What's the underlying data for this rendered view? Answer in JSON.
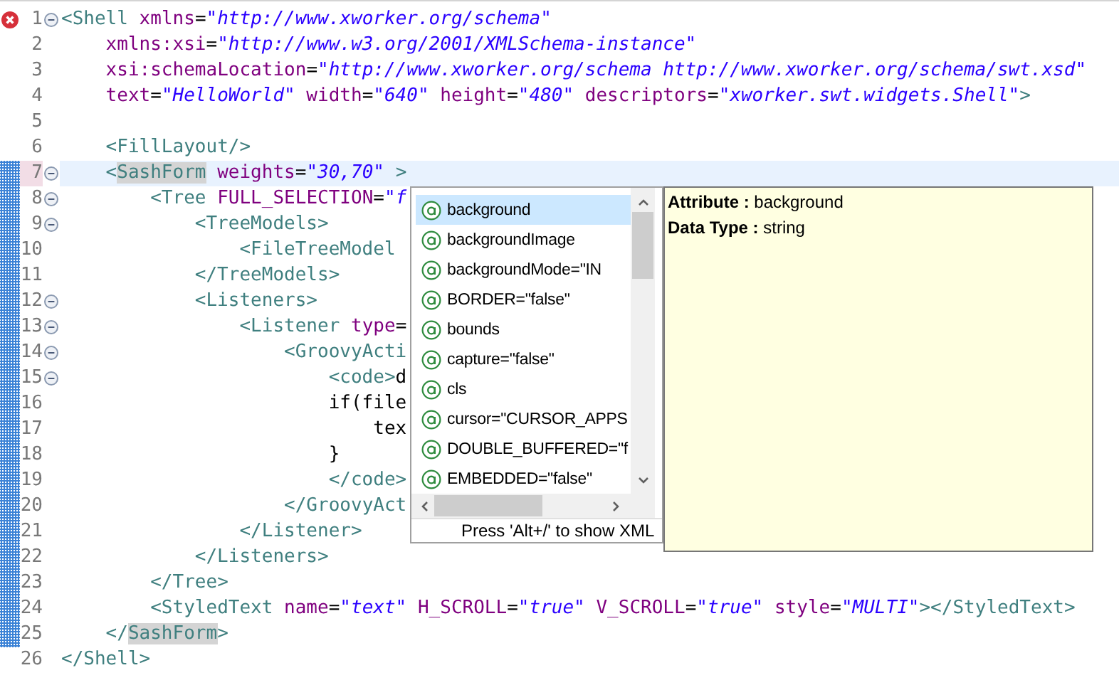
{
  "editor": {
    "lines": [
      {
        "number": "1",
        "error": true,
        "foldable": true,
        "changed": false,
        "current": false,
        "tokens": [
          {
            "kind": "tag",
            "text": "<Shell"
          },
          {
            "kind": "attr",
            "text": " xmlns"
          },
          {
            "kind": "eq",
            "text": "="
          },
          {
            "kind": "value",
            "text": "\"http://www.xworker.org/schema\""
          }
        ]
      },
      {
        "number": "2",
        "error": false,
        "foldable": false,
        "changed": false,
        "current": false,
        "tokens": [
          {
            "kind": "attr",
            "text": "    xmlns:xsi"
          },
          {
            "kind": "eq",
            "text": "="
          },
          {
            "kind": "value",
            "text": "\"http://www.w3.org/2001/XMLSchema-instance\""
          }
        ]
      },
      {
        "number": "3",
        "error": false,
        "foldable": false,
        "changed": false,
        "current": false,
        "tokens": [
          {
            "kind": "attr",
            "text": "    xsi:schemaLocation"
          },
          {
            "kind": "eq",
            "text": "="
          },
          {
            "kind": "value",
            "text": "\"http://www.xworker.org/schema http://www.xworker.org/schema/swt.xsd\""
          }
        ]
      },
      {
        "number": "4",
        "error": false,
        "foldable": false,
        "changed": false,
        "current": false,
        "tokens": [
          {
            "kind": "attr",
            "text": "    text"
          },
          {
            "kind": "eq",
            "text": "="
          },
          {
            "kind": "value",
            "text": "\"HelloWorld\""
          },
          {
            "kind": "attr",
            "text": " width"
          },
          {
            "kind": "eq",
            "text": "="
          },
          {
            "kind": "value",
            "text": "\"640\""
          },
          {
            "kind": "attr",
            "text": " height"
          },
          {
            "kind": "eq",
            "text": "="
          },
          {
            "kind": "value",
            "text": "\"480\""
          },
          {
            "kind": "attr",
            "text": " descriptors"
          },
          {
            "kind": "eq",
            "text": "="
          },
          {
            "kind": "value",
            "text": "\"xworker.swt.widgets.Shell\""
          },
          {
            "kind": "tag",
            "text": ">"
          }
        ]
      },
      {
        "number": "5",
        "error": false,
        "foldable": false,
        "changed": false,
        "current": false
      },
      {
        "number": "6",
        "error": false,
        "foldable": false,
        "changed": false,
        "current": false,
        "tokens": [
          {
            "kind": "tag",
            "text": "    <FillLayout/>"
          }
        ]
      },
      {
        "number": "7",
        "error": false,
        "foldable": true,
        "changed": true,
        "current": true,
        "tokens": [
          {
            "kind": "tag",
            "text": "    <"
          },
          {
            "kind": "match",
            "text": "SashForm"
          },
          {
            "kind": "attr",
            "text": " weights"
          },
          {
            "kind": "eq",
            "text": "="
          },
          {
            "kind": "value",
            "text": "\"30,70\""
          },
          {
            "kind": "tag",
            "text": " >"
          }
        ]
      },
      {
        "number": "8",
        "error": false,
        "foldable": true,
        "changed": true,
        "current": false,
        "tokens": [
          {
            "kind": "tag",
            "text": "        <Tree"
          },
          {
            "kind": "attr",
            "text": " FULL_SELECTION"
          },
          {
            "kind": "eq",
            "text": "="
          },
          {
            "kind": "value",
            "text": "\"f"
          }
        ]
      },
      {
        "number": "9",
        "error": false,
        "foldable": true,
        "changed": true,
        "current": false,
        "tokens": [
          {
            "kind": "tag",
            "text": "            <TreeModels>"
          }
        ]
      },
      {
        "number": "10",
        "error": false,
        "foldable": false,
        "changed": true,
        "current": false,
        "tokens": [
          {
            "kind": "tag",
            "text": "                <FileTreeModel"
          }
        ]
      },
      {
        "number": "11",
        "error": false,
        "foldable": false,
        "changed": true,
        "current": false,
        "tokens": [
          {
            "kind": "tag",
            "text": "            </TreeModels>"
          }
        ]
      },
      {
        "number": "12",
        "error": false,
        "foldable": true,
        "changed": true,
        "current": false,
        "tokens": [
          {
            "kind": "tag",
            "text": "            <Listeners>"
          }
        ]
      },
      {
        "number": "13",
        "error": false,
        "foldable": true,
        "changed": true,
        "current": false,
        "tokens": [
          {
            "kind": "tag",
            "text": "                <Listener"
          },
          {
            "kind": "attr",
            "text": " type"
          },
          {
            "kind": "eq",
            "text": "="
          }
        ]
      },
      {
        "number": "14",
        "error": false,
        "foldable": true,
        "changed": true,
        "current": false,
        "tokens": [
          {
            "kind": "tag",
            "text": "                    <GroovyActi"
          }
        ]
      },
      {
        "number": "15",
        "error": false,
        "foldable": true,
        "changed": true,
        "current": false,
        "tokens": [
          {
            "kind": "tag",
            "text": "                        <code>"
          },
          {
            "kind": "plain",
            "text": "d"
          }
        ]
      },
      {
        "number": "16",
        "error": false,
        "foldable": false,
        "changed": true,
        "current": false,
        "tokens": [
          {
            "kind": "plain",
            "text": "                        if(file"
          }
        ]
      },
      {
        "number": "17",
        "error": false,
        "foldable": false,
        "changed": true,
        "current": false,
        "tokens": [
          {
            "kind": "plain",
            "text": "                            tex"
          }
        ]
      },
      {
        "number": "18",
        "error": false,
        "foldable": false,
        "changed": true,
        "current": false,
        "tokens": [
          {
            "kind": "plain",
            "text": "                        }"
          }
        ]
      },
      {
        "number": "19",
        "error": false,
        "foldable": false,
        "changed": true,
        "current": false,
        "tokens": [
          {
            "kind": "tag",
            "text": "                        </code>"
          }
        ]
      },
      {
        "number": "20",
        "error": false,
        "foldable": false,
        "changed": true,
        "current": false,
        "tokens": [
          {
            "kind": "tag",
            "text": "                    </GroovyAct"
          }
        ]
      },
      {
        "number": "21",
        "error": false,
        "foldable": false,
        "changed": true,
        "current": false,
        "tokens": [
          {
            "kind": "tag",
            "text": "                </Listener>"
          }
        ]
      },
      {
        "number": "22",
        "error": false,
        "foldable": false,
        "changed": true,
        "current": false,
        "tokens": [
          {
            "kind": "tag",
            "text": "            </Listeners>"
          }
        ]
      },
      {
        "number": "23",
        "error": false,
        "foldable": false,
        "changed": true,
        "current": false,
        "tokens": [
          {
            "kind": "tag",
            "text": "        </Tree>"
          }
        ]
      },
      {
        "number": "24",
        "error": false,
        "foldable": false,
        "changed": true,
        "current": false,
        "tokens": [
          {
            "kind": "tag",
            "text": "        <StyledText"
          },
          {
            "kind": "attr",
            "text": " name"
          },
          {
            "kind": "eq",
            "text": "="
          },
          {
            "kind": "value",
            "text": "\"text\""
          },
          {
            "kind": "attr",
            "text": " H_SCROLL"
          },
          {
            "kind": "eq",
            "text": "="
          },
          {
            "kind": "value",
            "text": "\"true\""
          },
          {
            "kind": "attr",
            "text": " V_SCROLL"
          },
          {
            "kind": "eq",
            "text": "="
          },
          {
            "kind": "value",
            "text": "\"true\""
          },
          {
            "kind": "attr",
            "text": " style"
          },
          {
            "kind": "eq",
            "text": "="
          },
          {
            "kind": "value",
            "text": "\"MULTI\""
          },
          {
            "kind": "tag",
            "text": "></StyledText>"
          }
        ]
      },
      {
        "number": "25",
        "error": false,
        "foldable": false,
        "changed": true,
        "current": false,
        "tokens": [
          {
            "kind": "tag",
            "text": "    </"
          },
          {
            "kind": "match",
            "text": "SashForm"
          },
          {
            "kind": "tag",
            "text": ">"
          }
        ]
      },
      {
        "number": "26",
        "error": false,
        "foldable": false,
        "changed": false,
        "current": false,
        "tokens": [
          {
            "kind": "tag",
            "text": "</Shell>"
          }
        ]
      }
    ]
  },
  "completion": {
    "items": [
      {
        "label": "background",
        "selected": true
      },
      {
        "label": "backgroundImage",
        "selected": false
      },
      {
        "label": "backgroundMode=\"IN",
        "selected": false
      },
      {
        "label": "BORDER=\"false\"",
        "selected": false
      },
      {
        "label": "bounds",
        "selected": false
      },
      {
        "label": "capture=\"false\"",
        "selected": false
      },
      {
        "label": "cls",
        "selected": false
      },
      {
        "label": "cursor=\"CURSOR_APPS",
        "selected": false
      },
      {
        "label": "DOUBLE_BUFFERED=\"f",
        "selected": false
      },
      {
        "label": "EMBEDDED=\"false\"",
        "selected": false
      }
    ],
    "footer": "Press 'Alt+/' to show XML"
  },
  "info": {
    "lines": [
      "**Attribute :** background",
      "**Data Type :** string"
    ]
  }
}
